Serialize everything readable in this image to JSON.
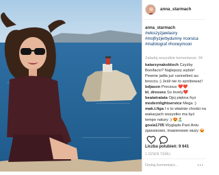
{
  "post": {
    "username": "anna_starmach"
  },
  "caption": {
    "username": "anna_starmach",
    "hashtags": "#wloszyzjawlasny #mojfryzjerbydumny #corsica #mafotograf #honeymoon"
  },
  "load_all_label": "Załaduj wszystkie komentarze: 34",
  "comments": [
    {
      "user": "katarzynakobloch",
      "text": "Czyżby Bonifacio? Najlepszy wybór! Pewnie jadła już cannelloni au brocciu ;) Jeśli nie to spróbować!"
    },
    {
      "user": "bdjason",
      "text": "Precious ❤️❤️"
    },
    {
      "user": "kt_dresses",
      "text": "So lovely❤️"
    },
    {
      "user": "beatatratata",
      "text": "Ojej piękna fryz"
    },
    {
      "user": "modernlightservice",
      "text": "Mega :)"
    },
    {
      "user": "mak.t.figa",
      "text": "I o to właśnie chodzi na wakacjach wszystko ma być tempo natury :) 😍🏝️"
    },
    {
      "user": "gosia1705",
      "text": "Wygląda Pani Aniu zjawiskowo, małżeństwo służy 😍"
    }
  ],
  "likes_label": "Liczba polubień: 9 641",
  "date_label": "1 DZIEŃ TEMU",
  "add_comment_placeholder": "Dodaj komentarz...",
  "colors": {
    "link": "#003569",
    "muted": "#999999",
    "text": "#262626"
  }
}
